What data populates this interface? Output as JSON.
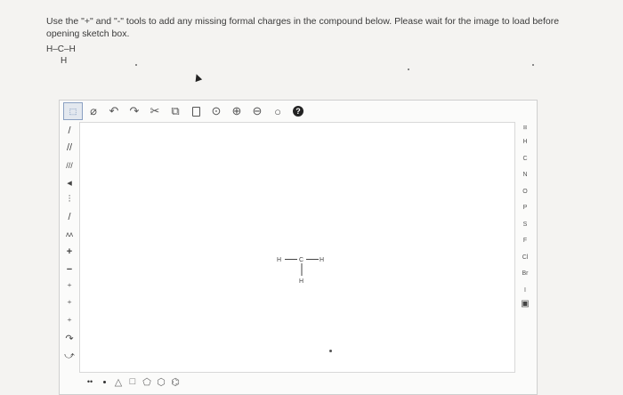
{
  "instructions": "Use the \"+\" and \"-\" tools to add any missing formal charges in the compound below. Please wait for the image to load before opening sketch box.",
  "preview": {
    "row1": "H–C–H",
    "row2": "H"
  },
  "top_toolbar": {
    "items": [
      {
        "name": "select-tool-icon",
        "glyph": "⬚"
      },
      {
        "name": "eraser-tool-icon",
        "glyph": "⌀"
      },
      {
        "name": "undo-icon",
        "glyph": "↶"
      },
      {
        "name": "redo-icon",
        "glyph": "↷"
      },
      {
        "name": "cut-icon",
        "glyph": "✂"
      },
      {
        "name": "copy-icon",
        "glyph": "⧉"
      },
      {
        "name": "paste-icon",
        "glyph": "📋"
      },
      {
        "name": "zoom-fit-icon",
        "glyph": "⊙"
      },
      {
        "name": "zoom-in-icon",
        "glyph": "⊕"
      },
      {
        "name": "zoom-out-icon",
        "glyph": "⊖"
      },
      {
        "name": "zoom-reset-icon",
        "glyph": "○"
      },
      {
        "name": "help-icon",
        "glyph": "?"
      }
    ]
  },
  "left_toolbar": {
    "items": [
      {
        "name": "single-bond-icon",
        "glyph": "/"
      },
      {
        "name": "double-bond-icon",
        "glyph": "//"
      },
      {
        "name": "triple-bond-icon",
        "glyph": "///"
      },
      {
        "name": "wedge-bond-icon",
        "glyph": "◂"
      },
      {
        "name": "hash-bond-icon",
        "glyph": "⫶"
      },
      {
        "name": "any-bond-icon",
        "glyph": "/"
      },
      {
        "name": "chain-tool-icon",
        "glyph": "ʌʌ"
      },
      {
        "name": "charge-plus-icon",
        "glyph": "+"
      },
      {
        "name": "charge-minus-icon",
        "glyph": "−"
      },
      {
        "name": "lone-pair-plus-icon",
        "glyph": "⁺"
      },
      {
        "name": "radical-plus-icon",
        "glyph": "⁺"
      },
      {
        "name": "electron-plus-icon",
        "glyph": "⁺"
      },
      {
        "name": "curved-arrow-icon",
        "glyph": "↷"
      },
      {
        "name": "half-arrow-icon",
        "glyph": "⤻"
      }
    ]
  },
  "right_toolbar": {
    "periodic_table": "⊞",
    "elements": [
      "H",
      "C",
      "N",
      "O",
      "P",
      "S",
      "F",
      "Cl",
      "Br",
      "I"
    ],
    "extra": "▣"
  },
  "bottom_toolbar": {
    "items": [
      {
        "name": "more-options-icon",
        "glyph": "••"
      },
      {
        "name": "cyclopropane-icon",
        "glyph": "△"
      },
      {
        "name": "cyclobutane-icon",
        "glyph": "□"
      },
      {
        "name": "cyclopentane-icon",
        "glyph": "⬠"
      },
      {
        "name": "cyclohexane-icon",
        "glyph": "⬡"
      },
      {
        "name": "benzene-icon",
        "glyph": "⌬"
      }
    ]
  },
  "molecule": {
    "h_left": "H",
    "c": "C",
    "h_right": "H",
    "h_bottom": "H"
  }
}
